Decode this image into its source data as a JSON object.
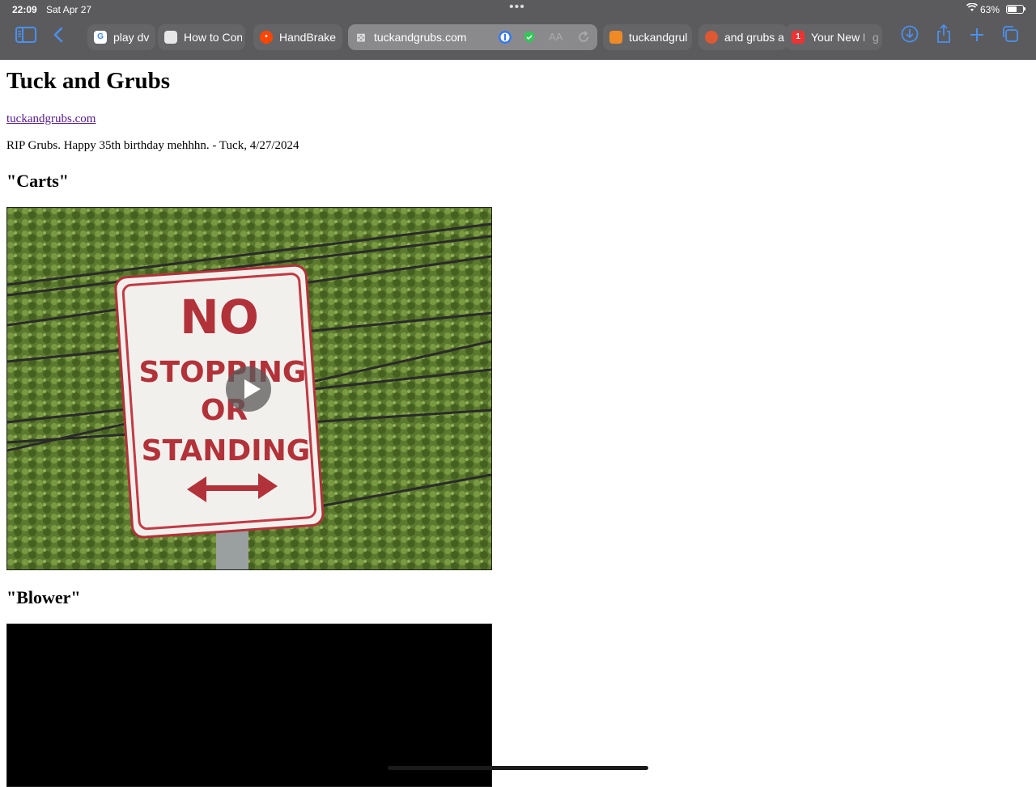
{
  "status_bar": {
    "time": "22:09",
    "date": "Sat Apr 27",
    "battery": "63%",
    "battery_level": 0.63
  },
  "tabs": [
    {
      "label": "play dv f",
      "favicon": "google-icon"
    },
    {
      "label": "How to Con",
      "favicon": "apple-icon"
    },
    {
      "label": "HandBrake",
      "favicon": "reddit-icon"
    },
    {
      "label": "tuckandgrubs.com",
      "favicon": "close-icon",
      "active": true
    },
    {
      "label": "tuckandgrul",
      "favicon": "box-icon"
    },
    {
      "label": "and grubs a",
      "favicon": "duckduckgo-icon"
    },
    {
      "label": "Your New Fa",
      "favicon": "app-icon"
    }
  ],
  "toolbar": {
    "reader_label": "AA",
    "overflow_text": "g"
  },
  "page": {
    "title": "Tuck and Grubs",
    "link": "tuckandgrubs.com",
    "message": "RIP Grubs. Happy 35th birthday mehhhn. - Tuck, 4/27/2024",
    "videos": [
      {
        "title": "\"Carts\"",
        "sign_lines": [
          "NO",
          "STOPPING",
          "OR",
          "STANDING"
        ]
      },
      {
        "title": "\"Blower\""
      }
    ]
  }
}
